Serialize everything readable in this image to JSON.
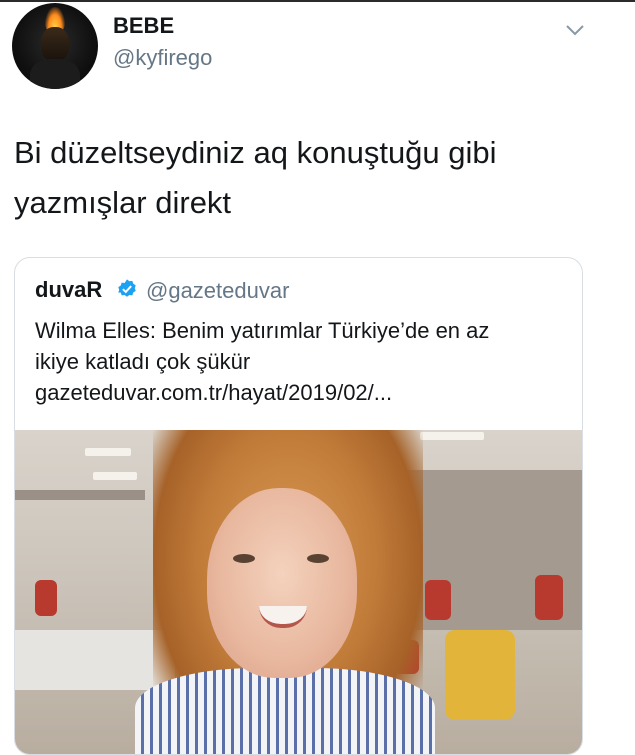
{
  "tweet": {
    "display_name": "BEBE",
    "handle": "@kyfirego",
    "text": "Bi düzeltseydiniz aq konuştuğu gibi yazmışlar direkt"
  },
  "quoted_tweet": {
    "name": "duvaR",
    "handle": "@gazeteduvar",
    "text_line1": "Wilma Elles: Benim yatırımlar Türkiye’de en az",
    "text_line2": "ikiye katladı çok şükür",
    "link": "gazeteduvar.com.tr/hayat/2019/02/..."
  },
  "icons": {
    "more": "chevron-down-icon",
    "verified": "verified-badge-icon"
  },
  "colors": {
    "text": "#14171a",
    "secondary": "#657786",
    "verified": "#1da1f2",
    "border": "#d8dee3"
  }
}
